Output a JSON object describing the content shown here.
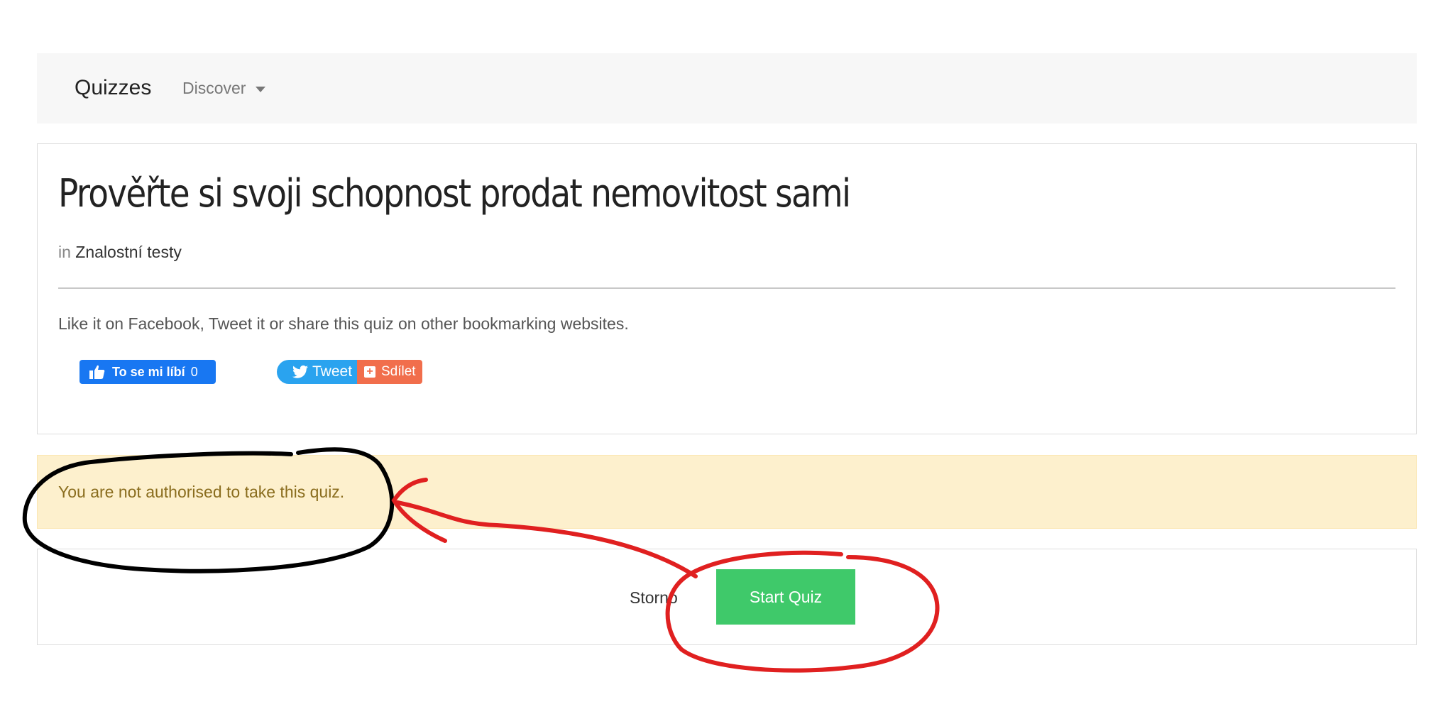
{
  "navbar": {
    "brand": "Quizzes",
    "discover_label": "Discover"
  },
  "quiz": {
    "title": "Prověřte si svoji schopnost prodat nemovitost sami",
    "category_prefix": "in",
    "category": "Znalostní testy",
    "share_text": "Like it on Facebook, Tweet it or share this quiz on other bookmarking websites."
  },
  "social": {
    "facebook_label": "To se mi líbí",
    "facebook_count": "0",
    "tweet_label": "Tweet",
    "share_label": "Sdílet"
  },
  "alert": {
    "message": "You are not authorised to take this quiz."
  },
  "actions": {
    "cancel_label": "Storno",
    "start_label": "Start Quiz"
  },
  "colors": {
    "facebook": "#1877f2",
    "twitter": "#2aa3ef",
    "share": "#f16e4c",
    "start_button": "#3fc96a",
    "alert_bg": "#fdf0cd",
    "alert_text": "#8a6d1e",
    "annotation_black": "#000000",
    "annotation_red": "#e02020"
  },
  "icons": [
    "caret-down-icon",
    "thumbs-up-icon",
    "twitter-bird-icon",
    "plus-icon"
  ]
}
